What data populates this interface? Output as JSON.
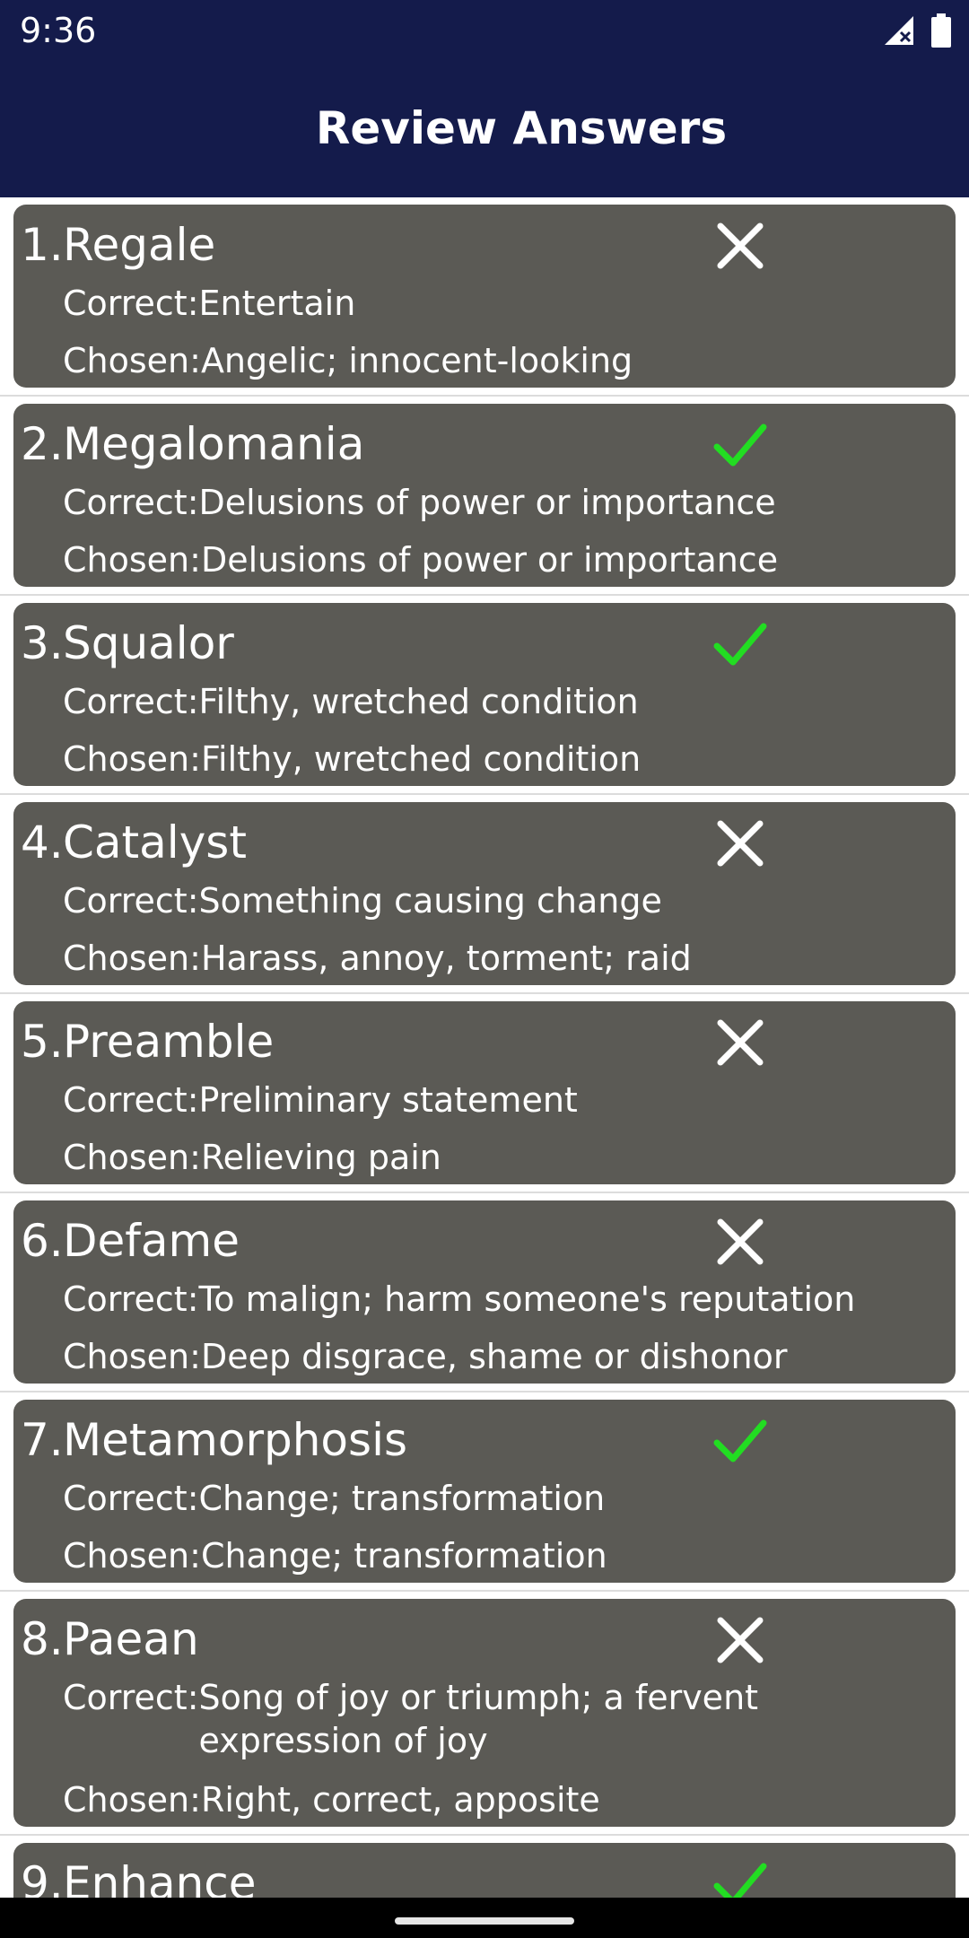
{
  "status_bar": {
    "time": "9:36",
    "icons": [
      "signal-icon",
      "battery-icon"
    ]
  },
  "header": {
    "title": "Review Answers"
  },
  "labels": {
    "correct": "Correct:",
    "chosen": "Chosen:"
  },
  "colors": {
    "app_bar": "#141b4b",
    "card": "#5b5a55",
    "check": "#22dd22",
    "cross": "#ffffff"
  },
  "answers": [
    {
      "number": "1.",
      "word": "Regale",
      "correct": "Entertain",
      "chosen": "Angelic; innocent-looking",
      "result": "wrong"
    },
    {
      "number": "2.",
      "word": "Megalomania",
      "correct": "Delusions of power or importance",
      "chosen": "Delusions of power or importance",
      "result": "right"
    },
    {
      "number": "3.",
      "word": "Squalor",
      "correct": "Filthy, wretched condition",
      "chosen": "Filthy, wretched condition",
      "result": "right"
    },
    {
      "number": "4.",
      "word": "Catalyst",
      "correct": "Something causing change",
      "chosen": "Harass, annoy, torment; raid",
      "result": "wrong"
    },
    {
      "number": "5.",
      "word": "Preamble",
      "correct": "Preliminary statement",
      "chosen": "Relieving pain",
      "result": "wrong"
    },
    {
      "number": "6.",
      "word": "Defame",
      "correct": "To malign; harm someone's reputation",
      "chosen": "Deep disgrace, shame or dishonor",
      "result": "wrong"
    },
    {
      "number": "7.",
      "word": "Metamorphosis",
      "correct": "Change; transformation",
      "chosen": "Change; transformation",
      "result": "right"
    },
    {
      "number": "8.",
      "word": "Paean",
      "correct": "Song of joy or triumph; a fervent expression of joy",
      "chosen": "Right, correct, apposite",
      "result": "wrong"
    },
    {
      "number": "9.",
      "word": "Enhance",
      "result": "right"
    }
  ]
}
